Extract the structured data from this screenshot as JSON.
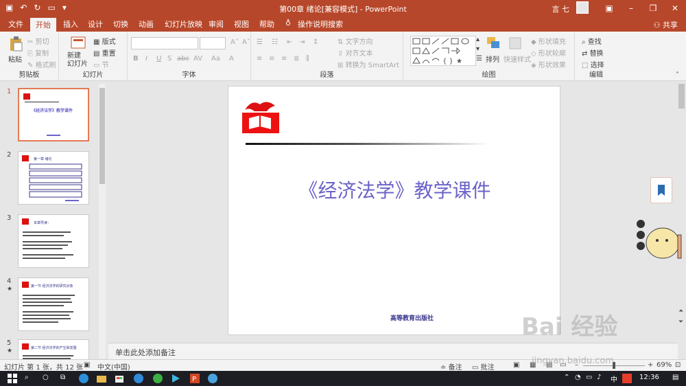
{
  "window": {
    "title": "第00章  绪论[兼容模式]  -  PowerPoint",
    "user": "言 七",
    "share": "共享"
  },
  "tabs": [
    "文件",
    "开始",
    "插入",
    "设计",
    "切换",
    "动画",
    "幻灯片放映",
    "审阅",
    "视图",
    "帮助"
  ],
  "tell_me": "操作说明搜索",
  "ribbon": {
    "clipboard": {
      "label": "剪贴板",
      "paste": "粘贴",
      "cut": "剪切",
      "copy": "复制",
      "format_painter": "格式刷"
    },
    "slides": {
      "label": "幻灯片",
      "new_slide": "新建\n幻灯片",
      "layout": "版式",
      "reset": "重置",
      "section": "节"
    },
    "font": {
      "label": "字体",
      "bold": "B",
      "italic": "I",
      "underline": "U",
      "shadow": "S",
      "strike": "abc",
      "spacing": "AV",
      "case": "Aa"
    },
    "paragraph": {
      "label": "段落",
      "text_direction": "文字方向",
      "align_text": "对齐文本",
      "smartart": "转换为 SmartArt"
    },
    "drawing": {
      "label": "绘图",
      "arrange": "排列",
      "quick_styles": "快速样式",
      "shape_fill": "形状填充",
      "shape_outline": "形状轮廓",
      "shape_effects": "形状效果"
    },
    "editing": {
      "label": "编辑",
      "find": "查找",
      "replace": "替换",
      "select": "选择"
    }
  },
  "slides_panel": {
    "items": [
      {
        "num": "1",
        "title": "《经济法学》教学课件",
        "starred": false
      },
      {
        "num": "2",
        "title": "第一章  绪论",
        "starred": false
      },
      {
        "num": "3",
        "title": "本章导读：",
        "starred": false
      },
      {
        "num": "4",
        "title": "第一节  经济法学的研究对象",
        "starred": true
      },
      {
        "num": "5",
        "title": "第二节  经济法学的产生和发展",
        "starred": true
      }
    ]
  },
  "slide": {
    "title": "《经济法学》教学课件",
    "publisher": "高等教育出版社"
  },
  "notes_placeholder": "单击此处添加备注",
  "status": {
    "slide_info": "幻灯片 第 1 张，共 12 张",
    "language": "中文(中国)",
    "notes": "备注",
    "comments": "批注",
    "zoom": "69%"
  },
  "taskbar": {
    "time": "12:36",
    "ime": "中"
  },
  "watermark": {
    "brand": "Bai 经验",
    "url": "jingyan.baidu.com"
  },
  "colors": {
    "accent": "#b7472a",
    "slide_title": "#6b63c9",
    "publisher": "#35338a"
  }
}
